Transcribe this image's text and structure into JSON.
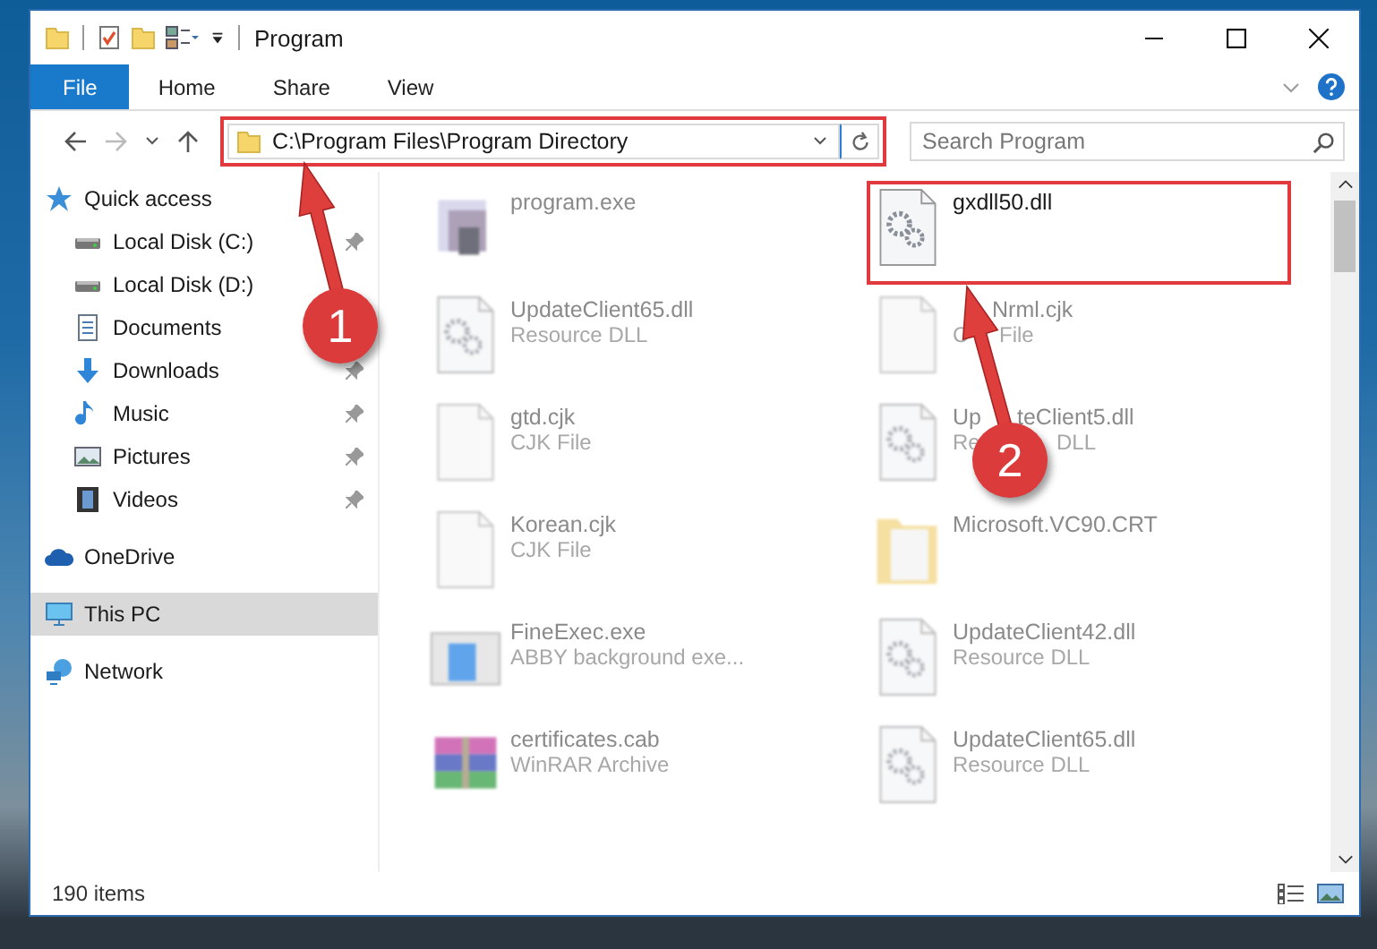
{
  "window": {
    "title": "Program"
  },
  "ribbon_tabs": [
    {
      "label": "File",
      "selected": true
    },
    {
      "label": "Home",
      "selected": false
    },
    {
      "label": "Share",
      "selected": false
    },
    {
      "label": "View",
      "selected": false
    }
  ],
  "address": {
    "value": "C:\\Program Files\\Program Directory",
    "highlighted": true
  },
  "search": {
    "placeholder": "Search Program"
  },
  "sidebar": {
    "items": [
      {
        "label": "Quick access",
        "kind": "star",
        "selected": false,
        "children": [
          {
            "label": "Local Disk (C:)",
            "kind": "disk",
            "pinned": true,
            "selected": false
          },
          {
            "label": "Local Disk (D:)",
            "kind": "disk",
            "selected": false
          },
          {
            "label": "Documents",
            "kind": "docs",
            "selected": false
          },
          {
            "label": "Downloads",
            "kind": "download",
            "pinned": true,
            "selected": false
          },
          {
            "label": "Music",
            "kind": "music",
            "pinned": true,
            "selected": false
          },
          {
            "label": "Pictures",
            "kind": "pictures",
            "pinned": true,
            "selected": false
          },
          {
            "label": "Videos",
            "kind": "videos",
            "pinned": true,
            "selected": false
          }
        ]
      },
      {
        "label": "OneDrive",
        "kind": "cloud",
        "selected": false
      },
      {
        "label": "This PC",
        "kind": "pc",
        "selected": true
      },
      {
        "label": "Network",
        "kind": "network",
        "selected": false
      }
    ]
  },
  "files": [
    {
      "name": "program.exe",
      "kind": "exe",
      "blurred": true,
      "highlighted": false
    },
    {
      "name": "gxdll50.dll",
      "kind": "dll",
      "blurred": false,
      "highlighted": true
    },
    {
      "name": "UpdateClient65.dll",
      "type": "Resource DLL",
      "kind": "dll",
      "blurred": true,
      "highlighted": false
    },
    {
      "name": "Nrml.cjk",
      "type_lead": "C",
      "type": "File",
      "covers": [
        {
          "kind": "arrow-tip"
        },
        {
          "kind": "arrow-upper"
        }
      ],
      "kind": "doc",
      "blurred": true,
      "highlighted": false
    },
    {
      "name": "gtd.cjk",
      "type": "CJK File",
      "kind": "doc",
      "blurred": true,
      "highlighted": false
    },
    {
      "name_lead": "Up",
      "name": "teClient5.dll",
      "type_lead": "Re",
      "type": "DLL",
      "covers": [
        {
          "kind": "arrow-lower"
        },
        {
          "kind": "circle"
        }
      ],
      "kind": "dll",
      "blurred": true,
      "highlighted": false
    },
    {
      "name": "Korean.cjk",
      "type": "CJK File",
      "kind": "doc",
      "blurred": true,
      "highlighted": false
    },
    {
      "name": "Microsoft.VC90.CRT",
      "kind": "folder",
      "blurred": true,
      "highlighted": false
    },
    {
      "name": "FineExec.exe",
      "type": "ABBY background exe...",
      "kind": "app",
      "blurred": true,
      "highlighted": false
    },
    {
      "name": "UpdateClient42.dll",
      "type": "Resource DLL",
      "kind": "dll",
      "blurred": true,
      "highlighted": false
    },
    {
      "name": "certificates.cab",
      "type": "WinRAR Archive",
      "kind": "archive",
      "blurred": true,
      "highlighted": false
    },
    {
      "name": "UpdateClient65.dll",
      "type": "Resource DLL",
      "kind": "dll",
      "blurred": true,
      "highlighted": false
    }
  ],
  "status_bar": {
    "item_count": "190 items"
  },
  "annotations": [
    {
      "number": "1"
    },
    {
      "number": "2"
    }
  ]
}
